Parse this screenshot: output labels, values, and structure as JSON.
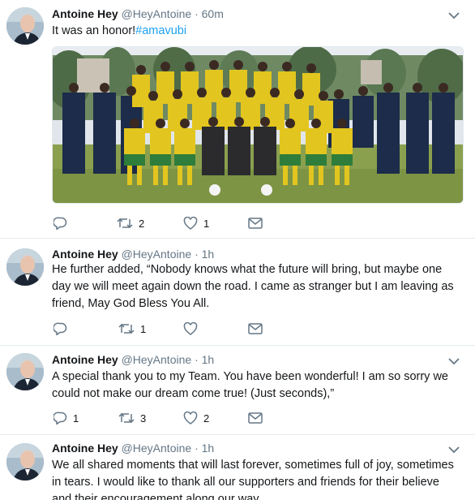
{
  "colors": {
    "accent": "#1da1f2",
    "muted": "#657786",
    "text": "#14171a"
  },
  "icons": {
    "reply": "reply-icon",
    "retweet": "retweet-icon",
    "like": "heart-icon",
    "dm": "envelope-icon",
    "menu": "chevron-down-icon"
  },
  "tweets": [
    {
      "name": "Antoine Hey",
      "handle": "@HeyAntoine",
      "separator": "·",
      "time": "60m",
      "text": "It was an honor!",
      "hashtag": "#amavubi",
      "replies": "",
      "retweets": "2",
      "likes": "1"
    },
    {
      "name": "Antoine Hey",
      "handle": "@HeyAntoine",
      "separator": "·",
      "time": "1h",
      "text": "He further added, “Nobody knows what the future will bring, but maybe one day we will meet again down the road. I came as stranger but I am leaving as friend, May God Bless You All.",
      "replies": "",
      "retweets": "1",
      "likes": ""
    },
    {
      "name": "Antoine Hey",
      "handle": "@HeyAntoine",
      "separator": "·",
      "time": "1h",
      "text": "A special thank you to my Team. You have been wonderful! I am so sorry we could not make our dream come true! (Just seconds),”",
      "replies": "1",
      "retweets": "3",
      "likes": "2"
    },
    {
      "name": "Antoine Hey",
      "handle": "@HeyAntoine",
      "separator": "·",
      "time": "1h",
      "text": "We all shared moments that will last forever, sometimes full of joy, sometimes in tears. I would like to thank all our supporters and friends for their believe and their encouragement along our way."
    }
  ]
}
